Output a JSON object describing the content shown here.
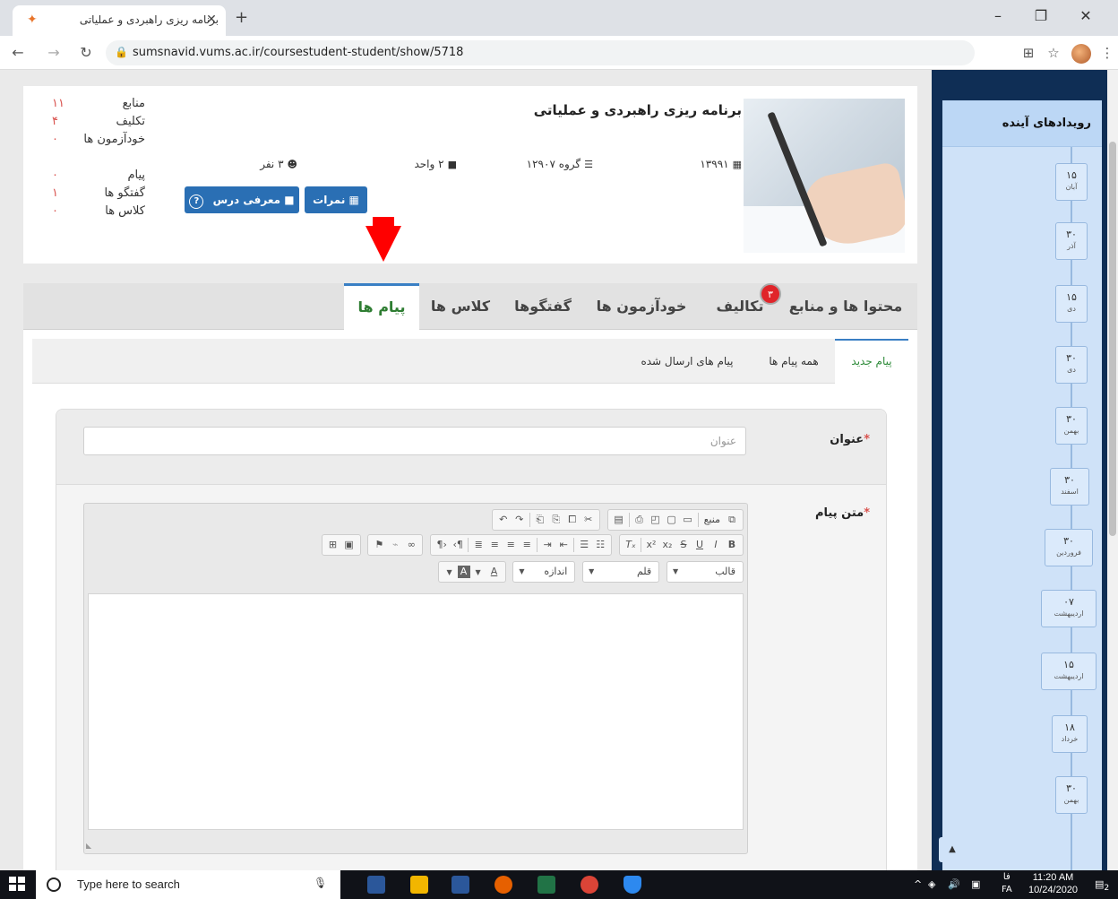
{
  "browser": {
    "tab_title": "برنامه ریزی راهبردی و عملیاتی",
    "url": "sumsnavid.vums.ac.ir/coursestudent-student/show/5718"
  },
  "stats": [
    {
      "label": "منابع",
      "value": "۱۱"
    },
    {
      "label": "تکلیف",
      "value": "۴"
    },
    {
      "label": "خودآزمون ها",
      "value": "۰"
    },
    {
      "label": "پیام",
      "value": "۰"
    },
    {
      "label": "گفتگو ها",
      "value": "۱"
    },
    {
      "label": "کلاس ها",
      "value": "۰"
    }
  ],
  "course": {
    "title": "برنامه ریزی راهبردی و عملیاتی",
    "year": "۱۳۹۹۱",
    "group": "گروه ۱۲۹۰۷",
    "units": "۲ واحد",
    "people": "۳ نفر",
    "grades_button": "نمرات",
    "intro_button": "معرفی درس",
    "help_icon_label": "?"
  },
  "main_tabs": {
    "content": "محتوا ها و منابع",
    "assignments": "تکالیف",
    "assignments_badge": "۳",
    "quizzes": "خودآزمون ها",
    "discussions": "گفتگوها",
    "classes": "کلاس ها",
    "messages": "پیام ها"
  },
  "sub_tabs": {
    "new": "پیام جدید",
    "all": "همه پیام ها",
    "sent": "پیام های ارسال شده"
  },
  "form": {
    "title_label": "عنوان",
    "title_placeholder": "عنوان",
    "body_label": "متن پیام",
    "required_mark": "*"
  },
  "editor": {
    "source_label": "منبع",
    "format_label": "قالب",
    "font_label": "قلم",
    "size_label": "اندازه"
  },
  "events": {
    "title": "رویدادهای آینده",
    "items": [
      {
        "day": "۱۵",
        "month": "آبان"
      },
      {
        "day": "۳۰",
        "month": "آذر"
      },
      {
        "day": "۱۵",
        "month": "دی"
      },
      {
        "day": "۳۰",
        "month": "دی"
      },
      {
        "day": "۳۰",
        "month": "بهمن"
      },
      {
        "day": "۳۰",
        "month": "اسفند"
      },
      {
        "day": "۳۰",
        "month": "فروردین"
      },
      {
        "day": "۰۷",
        "month": "اردیبهشت"
      },
      {
        "day": "۱۵",
        "month": "اردیبهشت"
      },
      {
        "day": "۱۸",
        "month": "خرداد"
      },
      {
        "day": "۳۰",
        "month": "بهمن"
      }
    ]
  },
  "taskbar": {
    "search_placeholder": "Type here to search",
    "lang_top": "فا",
    "lang_bottom": "FA",
    "time": "11:20 AM",
    "date": "10/24/2020",
    "notif_count": "2"
  },
  "colors": {
    "sidebar_bg": "#0f2e55",
    "button_blue": "#2a6fb4",
    "active_green": "#2e7d32",
    "badge_red": "#e0252a"
  }
}
